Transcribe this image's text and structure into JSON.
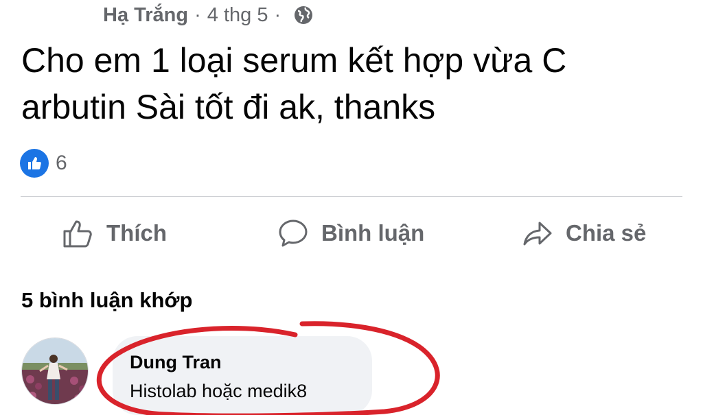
{
  "post": {
    "author": "Hạ Trắng",
    "separator": "·",
    "timestamp": "4 thg 5",
    "text": "Cho em 1 loại serum kết hợp vừa C arbutin Sài tốt đi ak, thanks",
    "reaction_count": "6"
  },
  "actions": {
    "like_label": "Thích",
    "comment_label": "Bình luận",
    "share_label": "Chia sẻ"
  },
  "comments": {
    "heading": "5 bình luận khớp",
    "items": [
      {
        "author": "Dung Tran",
        "text": "Histolab hoặc medik8"
      }
    ]
  },
  "colors": {
    "meta_gray": "#65676b",
    "like_blue": "#1b74e4",
    "bubble_bg": "#f0f2f5",
    "annotation_red": "#d9232b"
  },
  "icons": [
    "globe-icon",
    "like-badge-icon",
    "thumbs-up-icon",
    "comment-icon",
    "share-icon"
  ]
}
